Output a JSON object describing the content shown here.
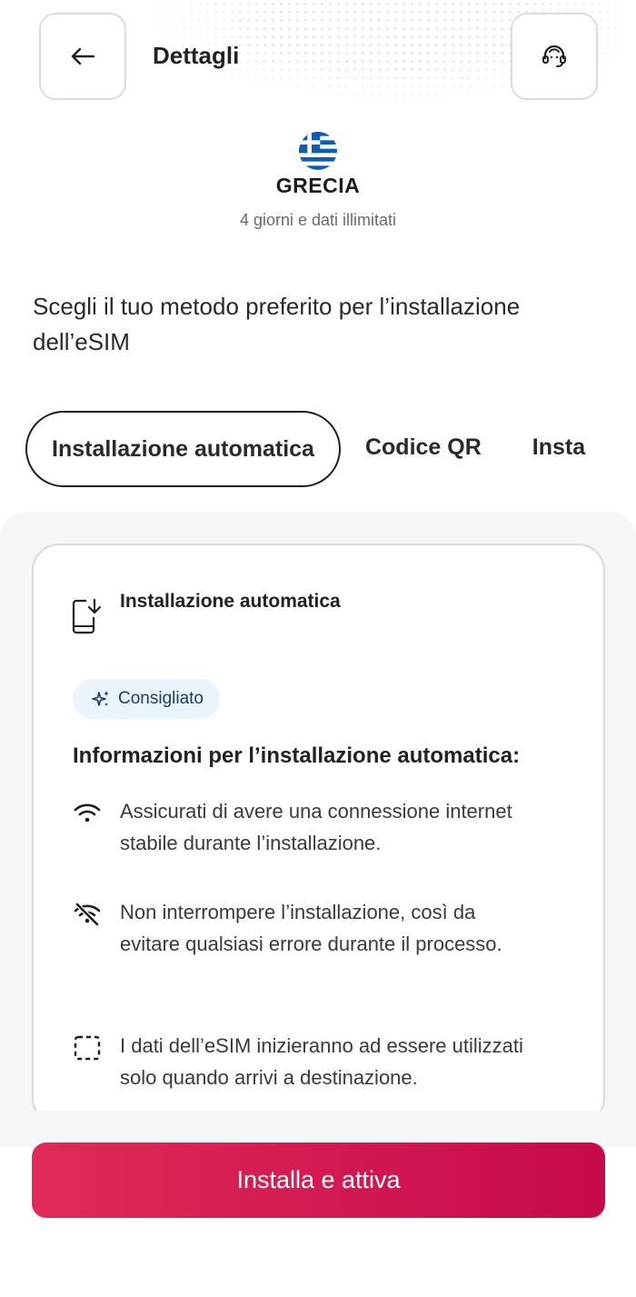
{
  "header": {
    "title": "Dettagli",
    "back_icon": "arrow-left-icon",
    "support_icon": "headset-icon"
  },
  "country": {
    "flag": "greece-flag",
    "name": "GRECIA",
    "plan": "4 giorni e dati illimitati"
  },
  "prompt": "Scegli il tuo metodo preferito per l’installazione dell’eSIM",
  "tabs": [
    {
      "label": "Installazione automatica",
      "active": true
    },
    {
      "label": "Codice QR",
      "active": false
    },
    {
      "label": "Insta",
      "active": false
    }
  ],
  "card": {
    "method_icon": "phone-download-icon",
    "method_title": "Installazione automatica",
    "badge": {
      "icon": "sparkle-icon",
      "label": "Consigliato"
    },
    "info_title": "Informazioni per l’installazione automatica:",
    "items": [
      {
        "icon": "wifi-icon",
        "text": "Assicurati di avere una connessione internet stabile durante l’installazione."
      },
      {
        "icon": "wifi-off-icon",
        "text": "Non interrompere l’installazione, così da evitare qualsiasi errore durante il processo."
      },
      {
        "icon": "dashed-square-icon",
        "text": "I dati dell’eSIM inizieranno ad essere utilizzati solo quando arrivi a destinazione."
      }
    ]
  },
  "cta": {
    "label": "Installa e attiva"
  },
  "colors": {
    "accent_start": "#e12a57",
    "accent_end": "#c60a4c",
    "badge_bg": "#e9f4fc",
    "panel_bg": "#f6f6f9",
    "greece_blue": "#0d5eaf"
  }
}
